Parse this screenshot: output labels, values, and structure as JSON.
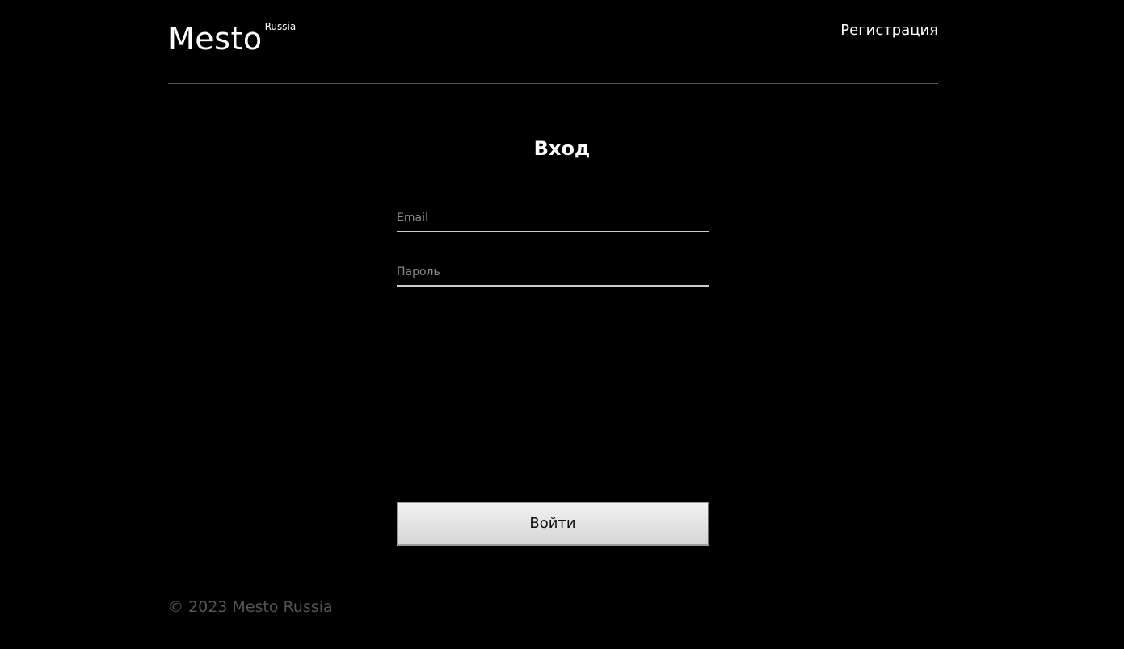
{
  "header": {
    "logo_text": "Mesto",
    "logo_superscript": "Russia",
    "nav_link": "Регистрация"
  },
  "login_form": {
    "title": "Вход",
    "email_placeholder": "Email",
    "password_placeholder": "Пароль",
    "submit_label": "Войти"
  },
  "footer": {
    "copyright": "© 2023 Mesto Russia"
  },
  "colors": {
    "background": "#000000",
    "text": "#ffffff",
    "divider": "#545454",
    "footer_text": "#545454",
    "placeholder": "#8c8c8c"
  }
}
